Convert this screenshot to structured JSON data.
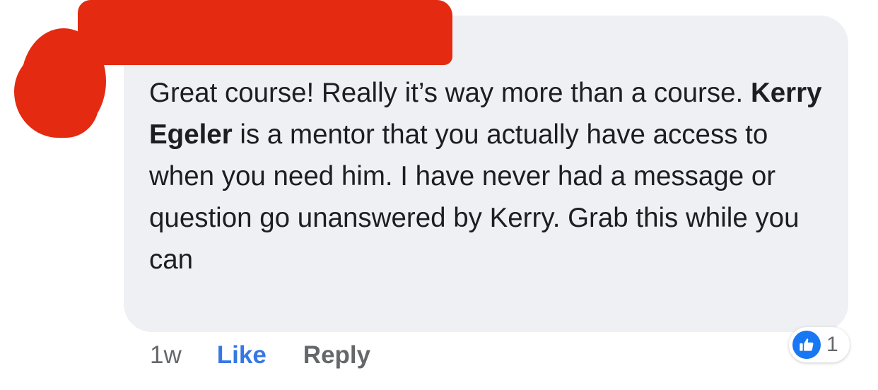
{
  "comment": {
    "author_name": "",
    "text_before": "Great course! Really it’s way more than a course. ",
    "mention": "Kerry Egeler",
    "text_after": " is a mentor that you actually have access to when you need him. I have never had a message or question go unanswered by Kerry. Grab this while you can"
  },
  "actions": {
    "timestamp": "1w",
    "like_label": "Like",
    "reply_label": "Reply"
  },
  "reactions": {
    "icon": "thumbs-up-icon",
    "count": "1"
  },
  "colors": {
    "bubble": "#eff0f3",
    "like_blue": "#3578e5",
    "redaction": "#e42a10"
  }
}
